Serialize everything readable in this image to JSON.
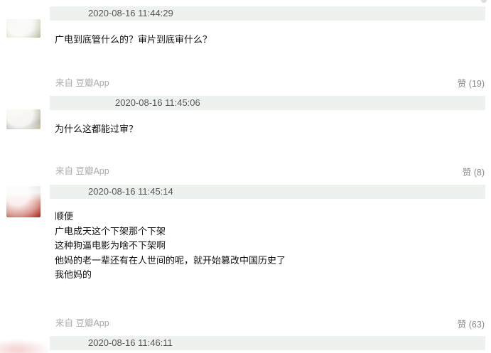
{
  "comments": [
    {
      "timestamp": "2020-08-16 11:44:29",
      "lines": [
        "广电到底管什么的？审片到底审什么？"
      ],
      "source": "来自 豆瓣App",
      "votes": "赞 (19)"
    },
    {
      "timestamp": "2020-08-16 11:45:06",
      "lines": [
        "为什么这都能过审？"
      ],
      "source": "来自 豆瓣App",
      "votes": "赞 (8)"
    },
    {
      "timestamp": "2020-08-16 11:45:14",
      "lines": [
        "顺便",
        "广电成天这个下架那个下架",
        "这种狗逼电影为啥不下架啊",
        "他妈的老一辈还有在人世间的呢，就开始篡改中国历史了",
        "我他妈的"
      ],
      "source": "来自 豆瓣App",
      "votes": "赞 (63)"
    },
    {
      "timestamp": "2020-08-16 11:46:11"
    }
  ],
  "colors": {
    "header_bar": "#eef2ee",
    "source_text": "#aaaaaa",
    "votes_text": "#888888"
  }
}
